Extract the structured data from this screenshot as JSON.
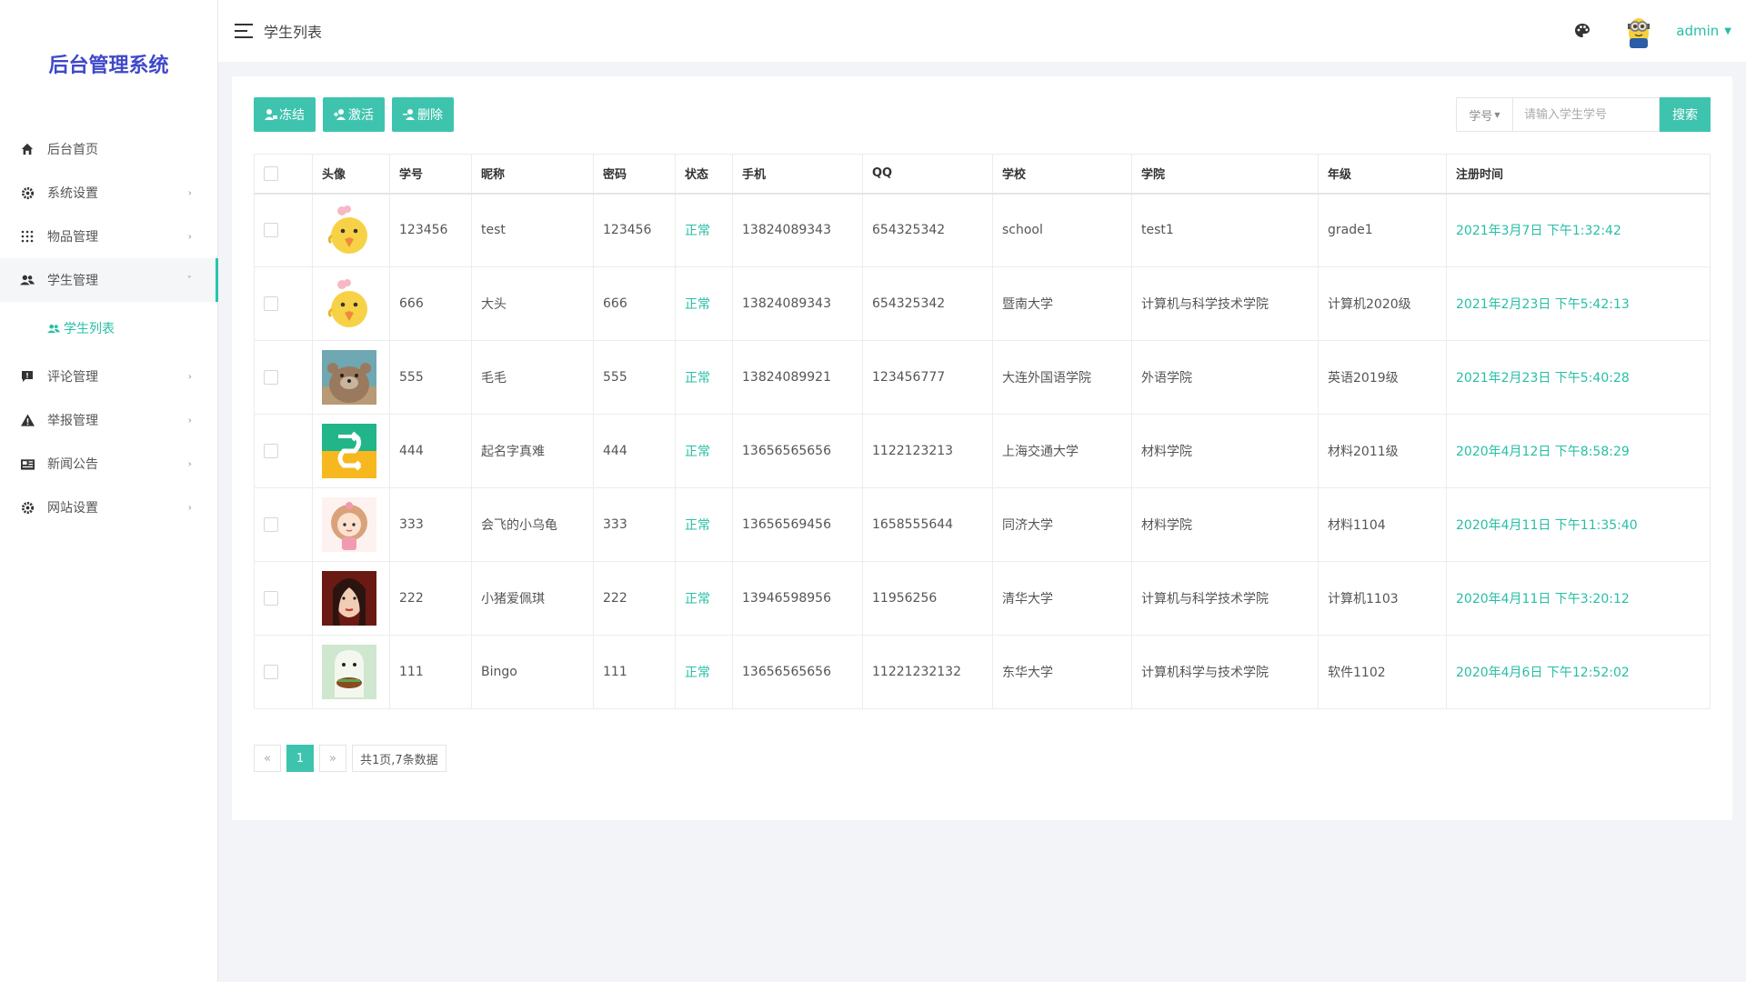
{
  "app": {
    "brand": "后台管理系统"
  },
  "sidebar": {
    "items": [
      {
        "label": "后台首页",
        "icon": "home-icon"
      },
      {
        "label": "系统设置",
        "icon": "gear-icon",
        "chevron": "›"
      },
      {
        "label": "物品管理",
        "icon": "grid-icon",
        "chevron": "›"
      },
      {
        "label": "学生管理",
        "icon": "users-icon",
        "chevron": "˅"
      },
      {
        "label": "评论管理",
        "icon": "comment-icon",
        "chevron": "›"
      },
      {
        "label": "举报管理",
        "icon": "warning-icon",
        "chevron": "›"
      },
      {
        "label": "新闻公告",
        "icon": "news-icon",
        "chevron": "›"
      },
      {
        "label": "网站设置",
        "icon": "gear-icon",
        "chevron": "›"
      }
    ],
    "sub_item": {
      "label": "学生列表",
      "icon": "users-icon"
    }
  },
  "topbar": {
    "title": "学生列表",
    "user": "admin"
  },
  "toolbar": {
    "freeze": "冻结",
    "activate": "激活",
    "delete": "删除"
  },
  "search": {
    "field": "学号",
    "placeholder": "请输入学生学号",
    "button": "搜索"
  },
  "table": {
    "headers": [
      "头像",
      "学号",
      "昵称",
      "密码",
      "状态",
      "手机",
      "QQ",
      "学校",
      "学院",
      "年级",
      "注册时间"
    ],
    "rows": [
      {
        "id": "123456",
        "nick": "test",
        "pwd": "123456",
        "status": "正常",
        "phone": "13824089343",
        "qq": "654325342",
        "school": "school",
        "college": "test1",
        "grade": "grade1",
        "time": "2021年3月7日 下午1:32:42",
        "avatar": "chick"
      },
      {
        "id": "666",
        "nick": "大头",
        "pwd": "666",
        "status": "正常",
        "phone": "13824089343",
        "qq": "654325342",
        "school": "暨南大学",
        "college": "计算机与科学技术学院",
        "grade": "计算机2020级",
        "time": "2021年2月23日 下午5:42:13",
        "avatar": "chick"
      },
      {
        "id": "555",
        "nick": "毛毛",
        "pwd": "555",
        "status": "正常",
        "phone": "13824089921",
        "qq": "123456777",
        "school": "大连外国语学院",
        "college": "外语学院",
        "grade": "英语2019级",
        "time": "2021年2月23日 下午5:40:28",
        "avatar": "bear"
      },
      {
        "id": "444",
        "nick": "起名字真难",
        "pwd": "444",
        "status": "正常",
        "phone": "13656565656",
        "qq": "1122123213",
        "school": "上海交通大学",
        "college": "材料学院",
        "grade": "材料2011级",
        "time": "2020年4月12日 下午8:58:29",
        "avatar": "swap"
      },
      {
        "id": "333",
        "nick": "会飞的小乌龟",
        "pwd": "333",
        "status": "正常",
        "phone": "13656569456",
        "qq": "1658555644",
        "school": "同济大学",
        "college": "材料学院",
        "grade": "材料1104",
        "time": "2020年4月11日 下午11:35:40",
        "avatar": "girl-cartoon"
      },
      {
        "id": "222",
        "nick": "小猪爱佩琪",
        "pwd": "222",
        "status": "正常",
        "phone": "13946598956",
        "qq": "11956256",
        "school": "清华大学",
        "college": "计算机与科学技术学院",
        "grade": "计算机1103",
        "time": "2020年4月11日 下午3:20:12",
        "avatar": "portrait"
      },
      {
        "id": "111",
        "nick": "Bingo",
        "pwd": "111",
        "status": "正常",
        "phone": "13656565656",
        "qq": "11221232132",
        "school": "东华大学",
        "college": "计算机科学与技术学院",
        "grade": "软件1102",
        "time": "2020年4月6日 下午12:52:02",
        "avatar": "ghost"
      }
    ]
  },
  "pagination": {
    "prev": "«",
    "current": "1",
    "next": "»",
    "info": "共1页,7条数据"
  },
  "colors": {
    "accent": "#3ec4ae",
    "brand": "#3f49c9"
  }
}
